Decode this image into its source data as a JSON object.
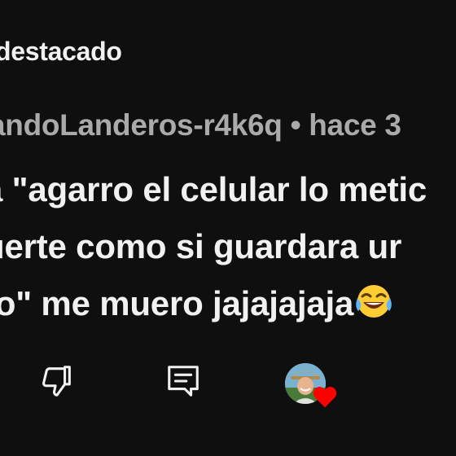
{
  "header": {
    "label": "destacado"
  },
  "comment": {
    "author": "andoLanderos-r4k6q",
    "separator": "•",
    "time": "hace 3",
    "lines": [
      "a \"agarro el celular lo metic",
      "uerte como si guardara ur",
      "to\" me muero jajajajaja"
    ],
    "emoji": "face-with-tears-of-joy"
  },
  "actions": {
    "dislike_icon": "thumbs-down-icon",
    "reply_icon": "reply-comment-icon",
    "creator_heart_icon": "heart-icon",
    "heart_color": "#ff0000"
  },
  "colors": {
    "background": "#0f0f0f",
    "primary_text": "#f1f1f1",
    "secondary_text": "#aaaaaa"
  }
}
